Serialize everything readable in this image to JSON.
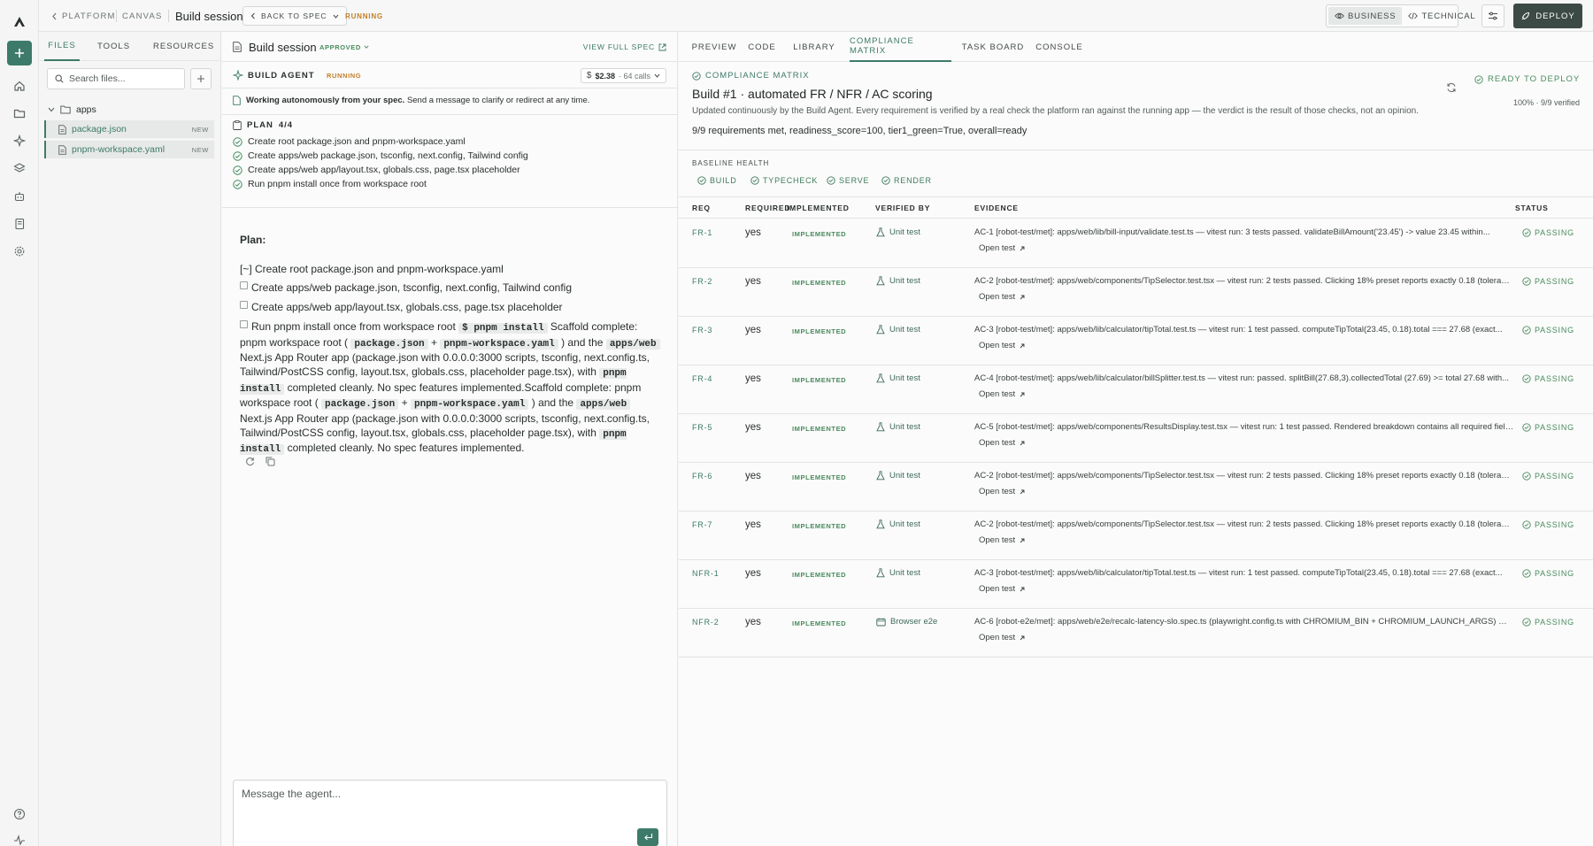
{
  "colors": {
    "accent": "#3e7a6a",
    "success": "#4b8a5f",
    "running": "#c47e2a",
    "deploy": "#3c4a46"
  },
  "rail": {
    "logo_icon": "triangle-logo-icon",
    "new_icon": "plus-icon",
    "nav": [
      "home-icon",
      "folder-icon",
      "sparkle-icon",
      "layers-icon",
      "bot-icon",
      "book-icon",
      "gear-icon"
    ],
    "bottom": [
      "help-icon",
      "activity-icon"
    ]
  },
  "topbar": {
    "platform": "PLATFORM",
    "canvas": "CANVAS",
    "session_title": "Build session",
    "back_to_spec": "BACK TO SPEC",
    "status": "RUNNING",
    "mode_business": "BUSINESS",
    "mode_technical": "TECHNICAL",
    "deploy": "DEPLOY"
  },
  "files": {
    "tabs": [
      "FILES",
      "TOOLS",
      "RESOURCES"
    ],
    "search_placeholder": "Search files...",
    "folder": "apps",
    "items": [
      {
        "name": "package.json",
        "badge": "NEW"
      },
      {
        "name": "pnpm-workspace.yaml",
        "badge": "NEW"
      }
    ]
  },
  "chat": {
    "title": "Build session",
    "approved": "APPROVED",
    "view_full_spec": "VIEW FULL SPEC",
    "agent_label": "BUILD AGENT",
    "agent_status": "RUNNING",
    "cost": "$2.38",
    "calls": "· 64 calls",
    "auto_note_bold": "Working autonomously from your spec.",
    "auto_note_rest": "Send a message to clarify or redirect at any time.",
    "plan_label": "PLAN",
    "plan_count": "4/4",
    "plan_items": [
      "Create root package.json and pnpm-workspace.yaml",
      "Create apps/web package.json, tsconfig, next.config, Tailwind config",
      "Create apps/web app/layout.tsx, globals.css, page.tsx placeholder",
      "Run pnpm install once from workspace root"
    ],
    "message": {
      "heading": "Plan:",
      "step1": "[~] Create root package.json and pnpm-workspace.yaml",
      "step2": "Create apps/web package.json, tsconfig, next.config, Tailwind config",
      "step3": "Create apps/web app/layout.tsx, globals.css, page.tsx placeholder",
      "step4_pre": "Run pnpm install once from workspace root",
      "cmd": "$ pnpm install",
      "s1": "Scaffold complete: pnpm workspace root (",
      "c_pkg": "package.json",
      "plus": "+",
      "c_ws": "pnpm-workspace.yaml",
      "s2": ") and the",
      "c_web": "apps/web",
      "s3": "Next.js App Router app (package.json with 0.0.0.0:3000 scripts, tsconfig, next.config.ts, Tailwind/PostCSS config, layout.tsx, globals.css, placeholder page.tsx), with",
      "c_pnpm": "pnpm install",
      "s4": "completed cleanly. No spec features implemented.Scaffold complete: pnpm workspace root (",
      "s5": "completed cleanly. No spec features implemented."
    },
    "composer_placeholder": "Message the agent..."
  },
  "right": {
    "tabs": [
      "PREVIEW",
      "CODE",
      "LIBRARY",
      "COMPLIANCE MATRIX",
      "TASK BOARD",
      "CONSOLE"
    ],
    "matrix_label": "COMPLIANCE MATRIX",
    "title": "Build #1 · automated FR / NFR / AC scoring",
    "description": "Updated continuously by the Build Agent. Every requirement is verified by a real check the platform ran against the running app — the verdict is the result of those checks, not an opinion.",
    "summary": "9/9 requirements met, readiness_score=100, tier1_green=True, overall=ready",
    "ready": "READY TO DEPLOY",
    "percent": "100% · 9/9 verified",
    "baseline_label": "BASELINE HEALTH",
    "baseline": [
      "BUILD",
      "TYPECHECK",
      "SERVE",
      "RENDER"
    ],
    "columns": [
      "REQ",
      "REQUIRED",
      "IMPLEMENTED",
      "VERIFIED BY",
      "EVIDENCE",
      "STATUS"
    ],
    "open_test": "Open test",
    "rows": [
      {
        "req": "FR-1",
        "required": "yes",
        "implemented": "IMPLEMENTED",
        "verified_by": "Unit test",
        "verify_icon": "flask-icon",
        "evidence": "AC-1 [robot-test/met]: apps/web/lib/bill-input/validate.test.ts — vitest run: 3 tests passed. validateBillAmount('23.45') -> value 23.45 within...",
        "status": "PASSING"
      },
      {
        "req": "FR-2",
        "required": "yes",
        "implemented": "IMPLEMENTED",
        "verified_by": "Unit test",
        "verify_icon": "flask-icon",
        "evidence": "AC-2 [robot-test/met]: apps/web/components/TipSelector.test.tsx — vitest run: 2 tests passed. Clicking 18% preset reports exactly 0.18 (toleranc...",
        "status": "PASSING"
      },
      {
        "req": "FR-3",
        "required": "yes",
        "implemented": "IMPLEMENTED",
        "verified_by": "Unit test",
        "verify_icon": "flask-icon",
        "evidence": "AC-3 [robot-test/met]: apps/web/lib/calculator/tipTotal.test.ts — vitest run: 1 test passed. computeTipTotal(23.45, 0.18).total === 27.68 (exact...",
        "status": "PASSING"
      },
      {
        "req": "FR-4",
        "required": "yes",
        "implemented": "IMPLEMENTED",
        "verified_by": "Unit test",
        "verify_icon": "flask-icon",
        "evidence": "AC-4 [robot-test/met]: apps/web/lib/calculator/billSplitter.test.ts — vitest run: passed. splitBill(27.68,3).collectedTotal (27.69) >= total 27.68 with...",
        "status": "PASSING"
      },
      {
        "req": "FR-5",
        "required": "yes",
        "implemented": "IMPLEMENTED",
        "verified_by": "Unit test",
        "verify_icon": "flask-icon",
        "evidence": "AC-5 [robot-test/met]: apps/web/components/ResultsDisplay.test.tsx — vitest run: 1 test passed. Rendered breakdown contains all required field...",
        "status": "PASSING"
      },
      {
        "req": "FR-6",
        "required": "yes",
        "implemented": "IMPLEMENTED",
        "verified_by": "Unit test",
        "verify_icon": "flask-icon",
        "evidence": "AC-2 [robot-test/met]: apps/web/components/TipSelector.test.tsx — vitest run: 2 tests passed. Clicking 18% preset reports exactly 0.18 (toleranc...",
        "status": "PASSING"
      },
      {
        "req": "FR-7",
        "required": "yes",
        "implemented": "IMPLEMENTED",
        "verified_by": "Unit test",
        "verify_icon": "flask-icon",
        "evidence": "AC-2 [robot-test/met]: apps/web/components/TipSelector.test.tsx — vitest run: 2 tests passed. Clicking 18% preset reports exactly 0.18 (toleranc...",
        "status": "PASSING"
      },
      {
        "req": "NFR-1",
        "required": "yes",
        "implemented": "IMPLEMENTED",
        "verified_by": "Unit test",
        "verify_icon": "flask-icon",
        "evidence": "AC-3 [robot-test/met]: apps/web/lib/calculator/tipTotal.test.ts — vitest run: 1 test passed. computeTipTotal(23.45, 0.18).total === 27.68 (exact...",
        "status": "PASSING"
      },
      {
        "req": "NFR-2",
        "required": "yes",
        "implemented": "IMPLEMENTED",
        "verified_by": "Browser e2e",
        "verify_icon": "browser-icon",
        "evidence": "AC-6 [robot-e2e/met]: apps/web/e2e/recalc-latency-slo.spec.ts (playwright.config.ts with CHROMIUM_BIN + CHROMIUM_LAUNCH_ARGS) — ran...",
        "status": "PASSING"
      }
    ]
  }
}
